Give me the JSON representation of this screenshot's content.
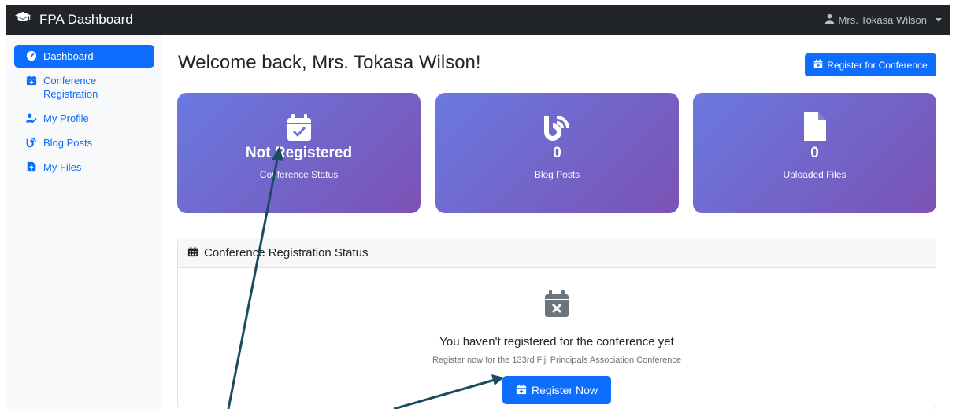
{
  "navbar": {
    "brand": "FPA Dashboard",
    "user": "Mrs. Tokasa Wilson"
  },
  "sidebar": {
    "items": [
      {
        "label": "Dashboard",
        "icon": "gauge-icon"
      },
      {
        "label": "Conference Registration",
        "icon": "calendar-plus-icon"
      },
      {
        "label": "My Profile",
        "icon": "user-edit-icon"
      },
      {
        "label": "Blog Posts",
        "icon": "blog-icon"
      },
      {
        "label": "My Files",
        "icon": "file-upload-icon"
      }
    ]
  },
  "main": {
    "title": "Welcome back, Mrs. Tokasa Wilson!",
    "register_button": "Register for Conference",
    "cards": [
      {
        "value": "Not Registered",
        "label": "Conference Status",
        "icon": "calendar-check-icon"
      },
      {
        "value": "0",
        "label": "Blog Posts",
        "icon": "blog-icon"
      },
      {
        "value": "0",
        "label": "Uploaded Files",
        "icon": "file-icon"
      }
    ],
    "panel": {
      "header": "Conference Registration Status",
      "message_title": "You haven't registered for the conference yet",
      "message_subtitle": "Register now for the 133rd Fiji Principals Association Conference",
      "button": "Register Now"
    }
  },
  "colors": {
    "navbar_bg": "#212529",
    "primary": "#0d6efd",
    "card_gradient_start": "#6a79e0",
    "card_gradient_end": "#7b52b4",
    "annotation_arrow": "#1b4b63"
  }
}
